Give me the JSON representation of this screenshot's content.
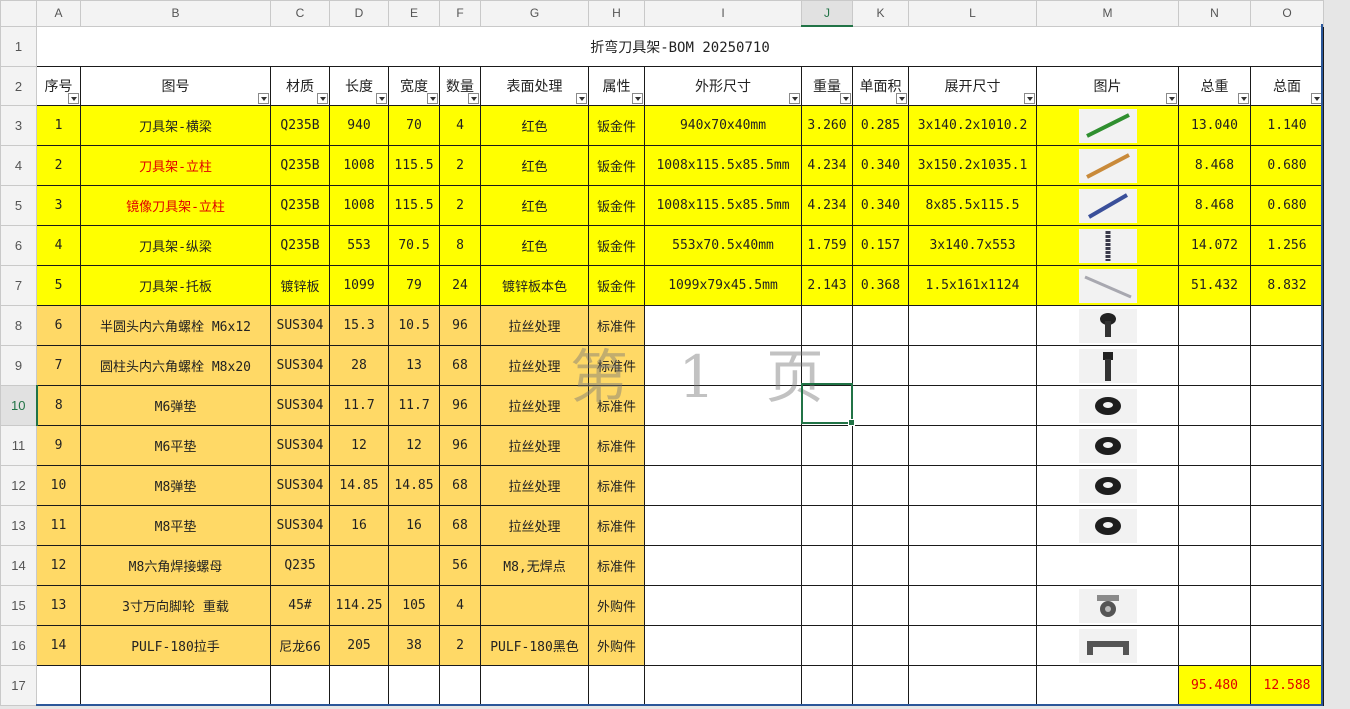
{
  "columns": [
    "A",
    "B",
    "C",
    "D",
    "E",
    "F",
    "G",
    "H",
    "I",
    "J",
    "K",
    "L",
    "M",
    "N",
    "O"
  ],
  "row_numbers": [
    "1",
    "2",
    "3",
    "4",
    "5",
    "6",
    "7",
    "8",
    "9",
    "10",
    "11",
    "12",
    "13",
    "14",
    "15",
    "16",
    "17"
  ],
  "title": "折弯刀具架-BOM 20250710",
  "headers": [
    "序号",
    "图号",
    "材质",
    "长度",
    "宽度",
    "数量",
    "表面处理",
    "属性",
    "外形尺寸",
    "重量",
    "单面积",
    "展开尺寸",
    "图片",
    "总重",
    "总面"
  ],
  "rows": [
    {
      "seq": "1",
      "name": "刀具架-横梁",
      "mat": "Q235B",
      "len": "940",
      "wid": "70",
      "qty": "4",
      "surf": "红色",
      "attr": "钣金件",
      "dim": "940x70x40mm",
      "wt": "3.260",
      "area": "0.285",
      "unf": "3x140.2x1010.2",
      "pic": "green-rail",
      "tw": "13.040",
      "ta": "1.140"
    },
    {
      "seq": "2",
      "name": "刀具架-立柱",
      "mat": "Q235B",
      "len": "1008",
      "wid": "115.5",
      "qty": "2",
      "surf": "红色",
      "attr": "钣金件",
      "dim": "1008x115.5x85.5mm",
      "wt": "4.234",
      "area": "0.340",
      "unf": "3x150.2x1035.1",
      "pic": "orange-post",
      "tw": "8.468",
      "ta": "0.680"
    },
    {
      "seq": "3",
      "name": "镜像刀具架-立柱",
      "mat": "Q235B",
      "len": "1008",
      "wid": "115.5",
      "qty": "2",
      "surf": "红色",
      "attr": "钣金件",
      "dim": "1008x115.5x85.5mm",
      "wt": "4.234",
      "area": "0.340",
      "unf": "8x85.5x115.5",
      "pic": "blue-post",
      "tw": "8.468",
      "ta": "0.680"
    },
    {
      "seq": "4",
      "name": "刀具架-纵梁",
      "mat": "Q235B",
      "len": "553",
      "wid": "70.5",
      "qty": "8",
      "surf": "红色",
      "attr": "钣金件",
      "dim": "553x70.5x40mm",
      "wt": "1.759",
      "area": "0.157",
      "unf": "3x140.7x553",
      "pic": "dark-beam",
      "tw": "14.072",
      "ta": "1.256"
    },
    {
      "seq": "5",
      "name": "刀具架-托板",
      "mat": "镀锌板",
      "len": "1099",
      "wid": "79",
      "qty": "24",
      "surf": "镀锌板本色",
      "attr": "钣金件",
      "dim": "1099x79x45.5mm",
      "wt": "2.143",
      "area": "0.368",
      "unf": "1.5x161x1124",
      "pic": "gray-plate",
      "tw": "51.432",
      "ta": "8.832"
    },
    {
      "seq": "6",
      "name": "半圆头内六角螺栓 M6x12",
      "mat": "SUS304",
      "len": "15.3",
      "wid": "10.5",
      "qty": "96",
      "surf": "拉丝处理",
      "attr": "标准件",
      "dim": "",
      "wt": "",
      "area": "",
      "unf": "",
      "pic": "bolt-short",
      "tw": "",
      "ta": ""
    },
    {
      "seq": "7",
      "name": "圆柱头内六角螺栓 M8x20",
      "mat": "SUS304",
      "len": "28",
      "wid": "13",
      "qty": "68",
      "surf": "拉丝处理",
      "attr": "标准件",
      "dim": "",
      "wt": "",
      "area": "",
      "unf": "",
      "pic": "bolt-long",
      "tw": "",
      "ta": ""
    },
    {
      "seq": "8",
      "name": "M6弹垫",
      "mat": "SUS304",
      "len": "11.7",
      "wid": "11.7",
      "qty": "96",
      "surf": "拉丝处理",
      "attr": "标准件",
      "dim": "",
      "wt": "",
      "area": "",
      "unf": "",
      "pic": "washer",
      "tw": "",
      "ta": ""
    },
    {
      "seq": "9",
      "name": "M6平垫",
      "mat": "SUS304",
      "len": "12",
      "wid": "12",
      "qty": "96",
      "surf": "拉丝处理",
      "attr": "标准件",
      "dim": "",
      "wt": "",
      "area": "",
      "unf": "",
      "pic": "washer",
      "tw": "",
      "ta": ""
    },
    {
      "seq": "10",
      "name": "M8弹垫",
      "mat": "SUS304",
      "len": "14.85",
      "wid": "14.85",
      "qty": "68",
      "surf": "拉丝处理",
      "attr": "标准件",
      "dim": "",
      "wt": "",
      "area": "",
      "unf": "",
      "pic": "washer",
      "tw": "",
      "ta": ""
    },
    {
      "seq": "11",
      "name": "M8平垫",
      "mat": "SUS304",
      "len": "16",
      "wid": "16",
      "qty": "68",
      "surf": "拉丝处理",
      "attr": "标准件",
      "dim": "",
      "wt": "",
      "area": "",
      "unf": "",
      "pic": "washer",
      "tw": "",
      "ta": ""
    },
    {
      "seq": "12",
      "name": "M8六角焊接螺母",
      "mat": "Q235",
      "len": "",
      "wid": "",
      "qty": "56",
      "surf": "M8,无焊点",
      "attr": "标准件",
      "dim": "",
      "wt": "",
      "area": "",
      "unf": "",
      "pic": "",
      "tw": "",
      "ta": ""
    },
    {
      "seq": "13",
      "name": "3寸万向脚轮 重载",
      "mat": "45#",
      "len": "114.25",
      "wid": "105",
      "qty": "4",
      "surf": "",
      "attr": "外购件",
      "dim": "",
      "wt": "",
      "area": "",
      "unf": "",
      "pic": "caster",
      "tw": "",
      "ta": ""
    },
    {
      "seq": "14",
      "name": "PULF-180拉手",
      "mat": "尼龙66",
      "len": "205",
      "wid": "38",
      "qty": "2",
      "surf": "PULF-180黑色",
      "attr": "外购件",
      "dim": "",
      "wt": "",
      "area": "",
      "unf": "",
      "pic": "handle",
      "tw": "",
      "ta": ""
    }
  ],
  "totals": {
    "weight": "95.480",
    "area": "12.588"
  },
  "watermark": "第 1 页",
  "red_name_rows": [
    1,
    2
  ],
  "colors": {
    "yellow": "#ffff00",
    "orange": "#ffd966",
    "selection": "#217346",
    "total_text": "#e00000"
  }
}
